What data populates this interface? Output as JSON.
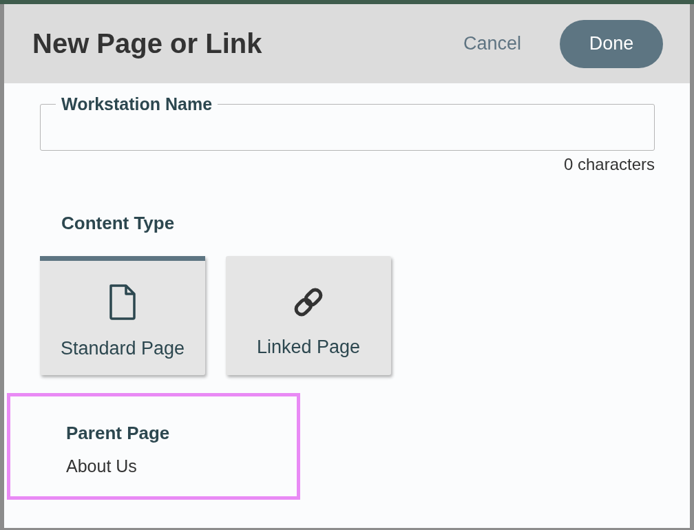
{
  "dialog": {
    "title": "New Page or Link",
    "cancel": "Cancel",
    "done": "Done"
  },
  "name_field": {
    "label": "Workstation Name",
    "counter": "0 characters"
  },
  "content_type": {
    "label": "Content Type",
    "options": [
      {
        "label": "Standard Page",
        "kind": "page",
        "selected": true
      },
      {
        "label": "Linked Page",
        "kind": "link",
        "selected": false
      }
    ]
  },
  "parent_page": {
    "label": "Parent Page",
    "value": "About Us",
    "highlighted": true
  }
}
